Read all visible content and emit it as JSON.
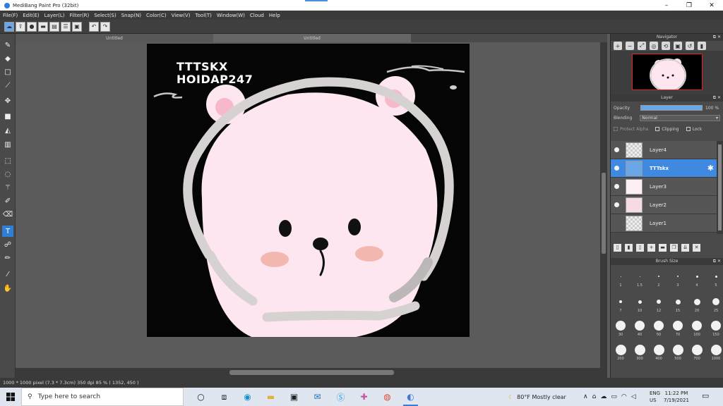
{
  "window": {
    "title": "MediBang Paint Pro (32bit)",
    "min": "–",
    "max": "❐",
    "close": "✕"
  },
  "menu": [
    "File(F)",
    "Edit(E)",
    "Layer(L)",
    "Filter(R)",
    "Select(S)",
    "Snap(N)",
    "Color(C)",
    "View(V)",
    "Tool(T)",
    "Window(W)",
    "Cloud",
    "Help"
  ],
  "tabs": [
    "Untitled",
    "Untitled"
  ],
  "canvas": {
    "text_line1": "TTTSKX",
    "text_line2": "HOIDAP247"
  },
  "navigator": {
    "title": "Navigator"
  },
  "layer_panel": {
    "title": "Layer",
    "opacity_label": "Opacity",
    "opacity_value": "100 %",
    "opacity_fraction": 1.0,
    "blending_label": "Blending",
    "blending_value": "Normal",
    "protect_alpha": "Protect Alpha",
    "clipping": "Clipping",
    "lock": "Lock",
    "layers": [
      {
        "name": "Layer4",
        "visible": true,
        "selected": false
      },
      {
        "name": "TTTskx",
        "visible": true,
        "selected": true
      },
      {
        "name": "Layer3",
        "visible": true,
        "selected": false
      },
      {
        "name": "Layer2",
        "visible": true,
        "selected": false
      },
      {
        "name": "Layer1",
        "visible": false,
        "selected": false
      }
    ]
  },
  "brush_size": {
    "title": "Brush Size",
    "rows": [
      [
        "1",
        "1.5",
        "2",
        "3",
        "4",
        "5"
      ],
      [
        "7",
        "10",
        "12",
        "15",
        "20",
        "25"
      ],
      [
        "30",
        "40",
        "50",
        "70",
        "100",
        "150"
      ],
      [
        "200",
        "300",
        "400",
        "500",
        "700",
        "1000"
      ]
    ]
  },
  "status": {
    "text": "1000 * 1000 pixel   (7.3 * 7.3cm)   350 dpi   85 %   ( 1352, 450 )"
  },
  "taskbar": {
    "search_placeholder": "Type here to search",
    "weather": "80°F  Mostly clear",
    "lang1": "ENG",
    "lang2": "US",
    "time": "11:22 PM",
    "date": "7/19/2021"
  },
  "colors": {
    "accent": "#3f8ae0",
    "canvas_bg": "#050505",
    "bear": "#fde6ef",
    "ring": "#d6d2d2"
  }
}
